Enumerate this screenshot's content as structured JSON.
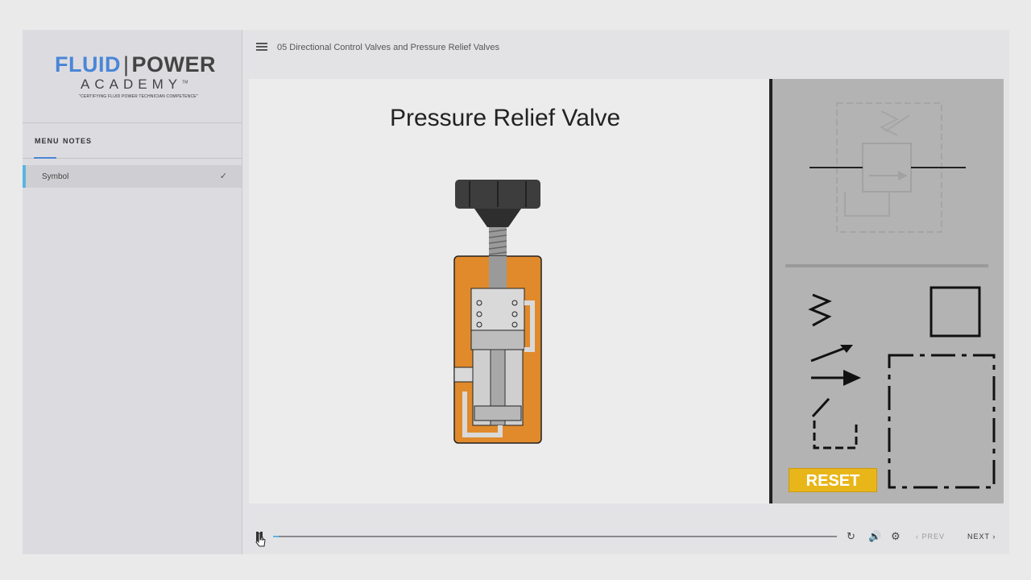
{
  "logo": {
    "fluid": "FLUID",
    "separator": "|",
    "power": "POWER",
    "academy": "ACADEMY",
    "tm": "TM",
    "tagline": "\"CERTIFYING FLUID POWER TECHNICIAN COMPETENCE\""
  },
  "tabs": {
    "menu": "MENU",
    "notes": "NOTES"
  },
  "menu": {
    "items": [
      {
        "label": "Symbol",
        "completed": true
      }
    ]
  },
  "header": {
    "title": "05 Directional Control Valves and Pressure Relief Valves"
  },
  "slide": {
    "title": "Pressure Relief Valve"
  },
  "panel": {
    "reset_label": "RESET"
  },
  "controls": {
    "prev_label": "PREV",
    "next_label": "NEXT",
    "progress": 0.01
  },
  "colors": {
    "accent": "#4a86d6",
    "progress": "#5bb4e0",
    "valve_body": "#e08a2c",
    "reset": "#e8b619"
  },
  "icons": [
    "hamburger-icon",
    "check-icon",
    "pause-icon",
    "replay-icon",
    "volume-icon",
    "settings-icon",
    "chevron-left-icon",
    "chevron-right-icon",
    "cursor-icon"
  ]
}
